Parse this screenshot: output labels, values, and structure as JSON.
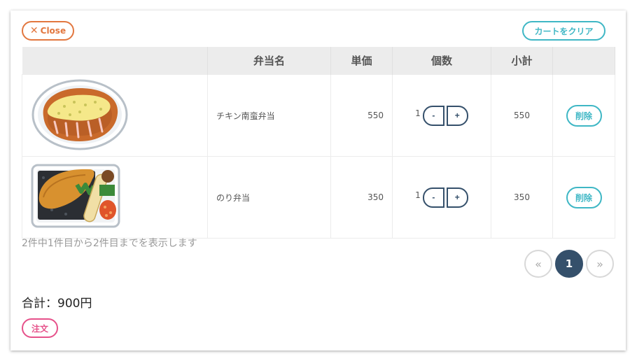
{
  "toolbar": {
    "close_label": "Close",
    "clear_label": "カートをクリア"
  },
  "table": {
    "headers": [
      "",
      "弁当名",
      "単価",
      "個数",
      "小計",
      ""
    ],
    "rows": [
      {
        "name": "チキン南蛮弁当",
        "price": "550",
        "qty": "1",
        "subtotal": "550",
        "delete_label": "削除",
        "image": "chicken-nanban-bento-image"
      },
      {
        "name": "のり弁当",
        "price": "350",
        "qty": "1",
        "subtotal": "350",
        "delete_label": "削除",
        "image": "nori-bento-image"
      }
    ],
    "minus_label": "-",
    "plus_label": "+"
  },
  "summary": "2件中1件目から2件目までを表示します",
  "pagination": {
    "prev": "«",
    "current": "1",
    "next": "»"
  },
  "total": "合計：900円",
  "order_label": "注文",
  "colors": {
    "close": "#e2773f",
    "clear": "#3fb7c5",
    "navy": "#35506b",
    "order": "#e6518a"
  }
}
